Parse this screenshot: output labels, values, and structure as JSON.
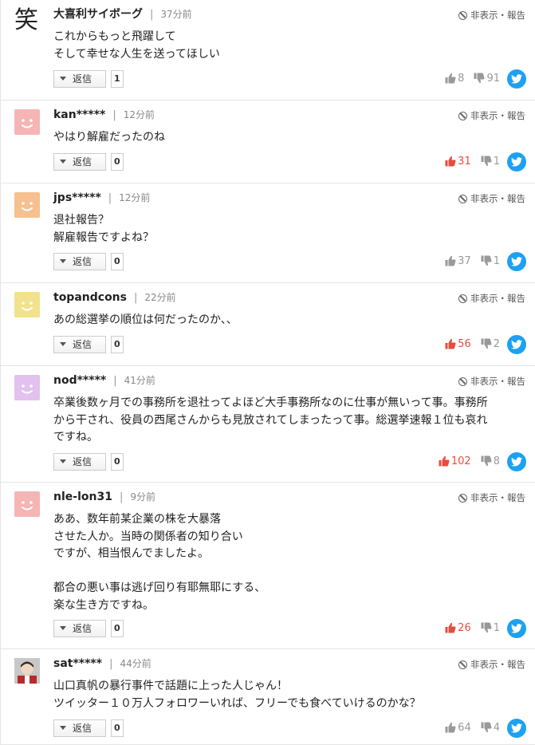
{
  "actions": {
    "reply_label": "返信",
    "hide_label": "非表示・報告"
  },
  "comments": [
    {
      "user": "大喜利サイボーグ",
      "time": "37分前",
      "avatar": "kanji-avatar",
      "avatar_text": "笑",
      "lines": [
        "これからもっと飛躍して",
        "そして幸せな人生を送ってほしい"
      ],
      "replies": "1",
      "likes": "8",
      "dislikes": "91",
      "likes_active": false
    },
    {
      "user": "kan*****",
      "time": "12分前",
      "avatar": "pink",
      "lines": [
        "やはり解雇だったのね"
      ],
      "replies": "0",
      "likes": "31",
      "dislikes": "1",
      "likes_active": true
    },
    {
      "user": "jps*****",
      "time": "12分前",
      "avatar": "orange",
      "lines": [
        "退社報告？",
        "解雇報告ですよね？"
      ],
      "replies": "0",
      "likes": "37",
      "dislikes": "1",
      "likes_active": false
    },
    {
      "user": "topandcons",
      "time": "22分前",
      "avatar": "yellow",
      "lines": [
        "あの総選挙の順位は何だったのか、、"
      ],
      "replies": "0",
      "likes": "56",
      "dislikes": "2",
      "likes_active": true
    },
    {
      "user": "nod*****",
      "time": "41分前",
      "avatar": "purple",
      "lines": [
        "卒業後数ヶ月での事務所を退社ってよほど大手事務所なのに仕事が無いって事。事務所",
        "から干され、役員の西尾さんからも見放されてしまったって事。総選挙速報１位も哀れ",
        "ですね。"
      ],
      "replies": "0",
      "likes": "102",
      "dislikes": "8",
      "likes_active": true
    },
    {
      "user": "nle-lon31",
      "time": "9分前",
      "avatar": "pink",
      "lines": [
        "ああ、数年前某企業の株を大暴落",
        "させた人か。当時の関係者の知り合い",
        "ですが、相当恨んでましたよ。",
        "",
        "都合の悪い事は逃げ回り有耶無耶にする、",
        "楽な生き方ですね。"
      ],
      "replies": "0",
      "likes": "26",
      "dislikes": "1",
      "likes_active": true
    },
    {
      "user": "sat*****",
      "time": "44分前",
      "avatar": "photo",
      "lines": [
        "山口真帆の暴行事件で話題に上った人じゃん！",
        "ツイッター１０万人フォロワーいれば、フリーでも食べていけるのかな？"
      ],
      "replies": "0",
      "likes": "64",
      "dislikes": "4",
      "likes_active": false
    }
  ],
  "colors": {
    "like_active": "#e74c3c",
    "twitter": "#1da1f2",
    "pink": "#f5b5b5",
    "orange": "#f7c08f",
    "yellow": "#f2e28c",
    "purple": "#e2c1ee"
  }
}
